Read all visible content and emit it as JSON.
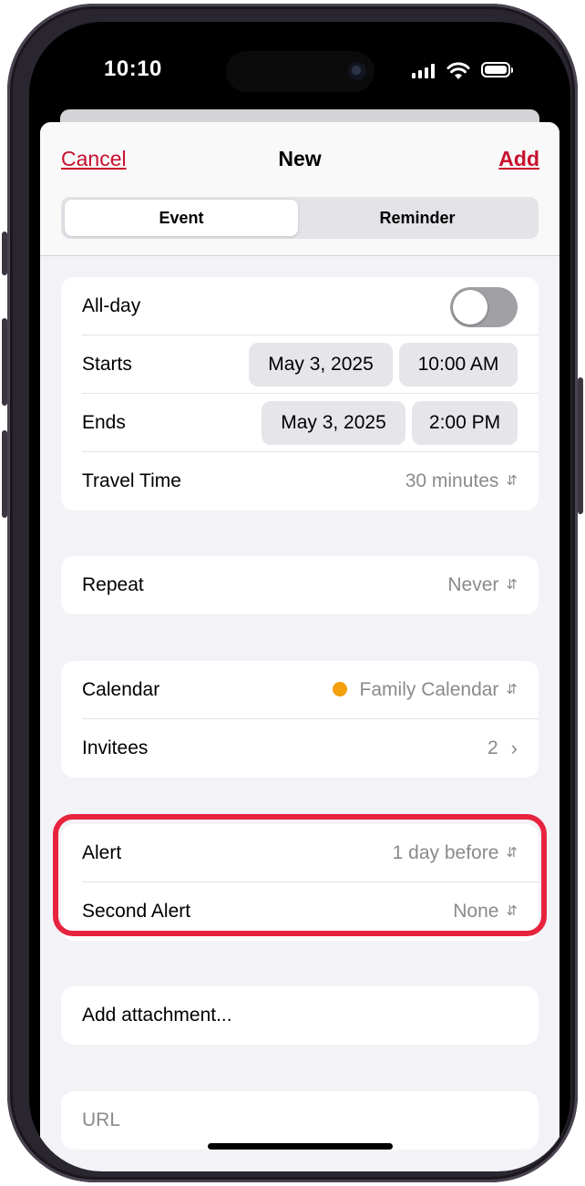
{
  "status": {
    "time": "10:10"
  },
  "header": {
    "cancel": "Cancel",
    "title": "New",
    "add": "Add",
    "segments": [
      "Event",
      "Reminder"
    ]
  },
  "schedule": {
    "allday": {
      "label": "All-day",
      "on": false
    },
    "starts": {
      "label": "Starts",
      "date": "May 3, 2025",
      "time": "10:00 AM"
    },
    "ends": {
      "label": "Ends",
      "date": "May 3, 2025",
      "time": "2:00 PM"
    },
    "travel": {
      "label": "Travel Time",
      "value": "30 minutes"
    }
  },
  "repeat": {
    "label": "Repeat",
    "value": "Never"
  },
  "calendar": {
    "label": "Calendar",
    "value": "Family Calendar",
    "color": "#f5a00d",
    "invitees_label": "Invitees",
    "invitees_value": "2"
  },
  "alerts": {
    "alert_label": "Alert",
    "alert_value": "1 day before",
    "second_label": "Second Alert",
    "second_value": "None",
    "highlight_color": "#e8233e"
  },
  "attachment": {
    "label": "Add attachment..."
  },
  "url": {
    "placeholder": "URL"
  },
  "icons": {
    "updown": "chevron-updown-icon",
    "right": "chevron-right-icon"
  }
}
